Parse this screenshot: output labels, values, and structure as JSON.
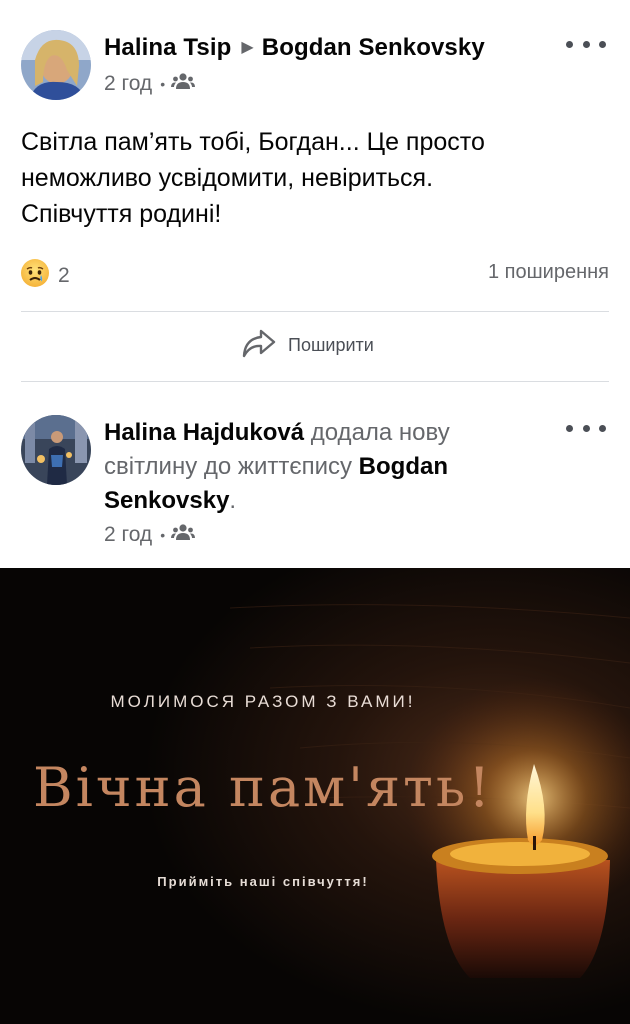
{
  "post1": {
    "author": "Halina Tsip",
    "target": "Bogdan  Senkovsky",
    "time": "2 год",
    "audience_icon": "friends-icon",
    "text_lines": [
      "Світла пам’ять тобі, Богдан... Це просто",
      "неможливо усвідомити, невіриться.",
      "Співчуття родині!"
    ],
    "reaction_icon": "sad-reaction-icon",
    "reaction_count": "2",
    "shares": "1 поширення",
    "share_label": "Поширити"
  },
  "post2": {
    "author": "Halina Hajduková",
    "action": "додала нову світлину до життєпису",
    "target": "Bogdan Senkovsky",
    "period": ".",
    "time": "2 год",
    "audience_icon": "friends-icon"
  },
  "photo": {
    "subtitle": "МОЛИМОСЯ РАЗОМ З ВАМИ!",
    "title": "Вічна пам'ять!",
    "caption": "Прийміть наші співчуття!"
  },
  "colors": {
    "text_primary": "#050505",
    "text_secondary": "#65676b",
    "divider": "#dadde1",
    "photo_title": "#c48660"
  }
}
